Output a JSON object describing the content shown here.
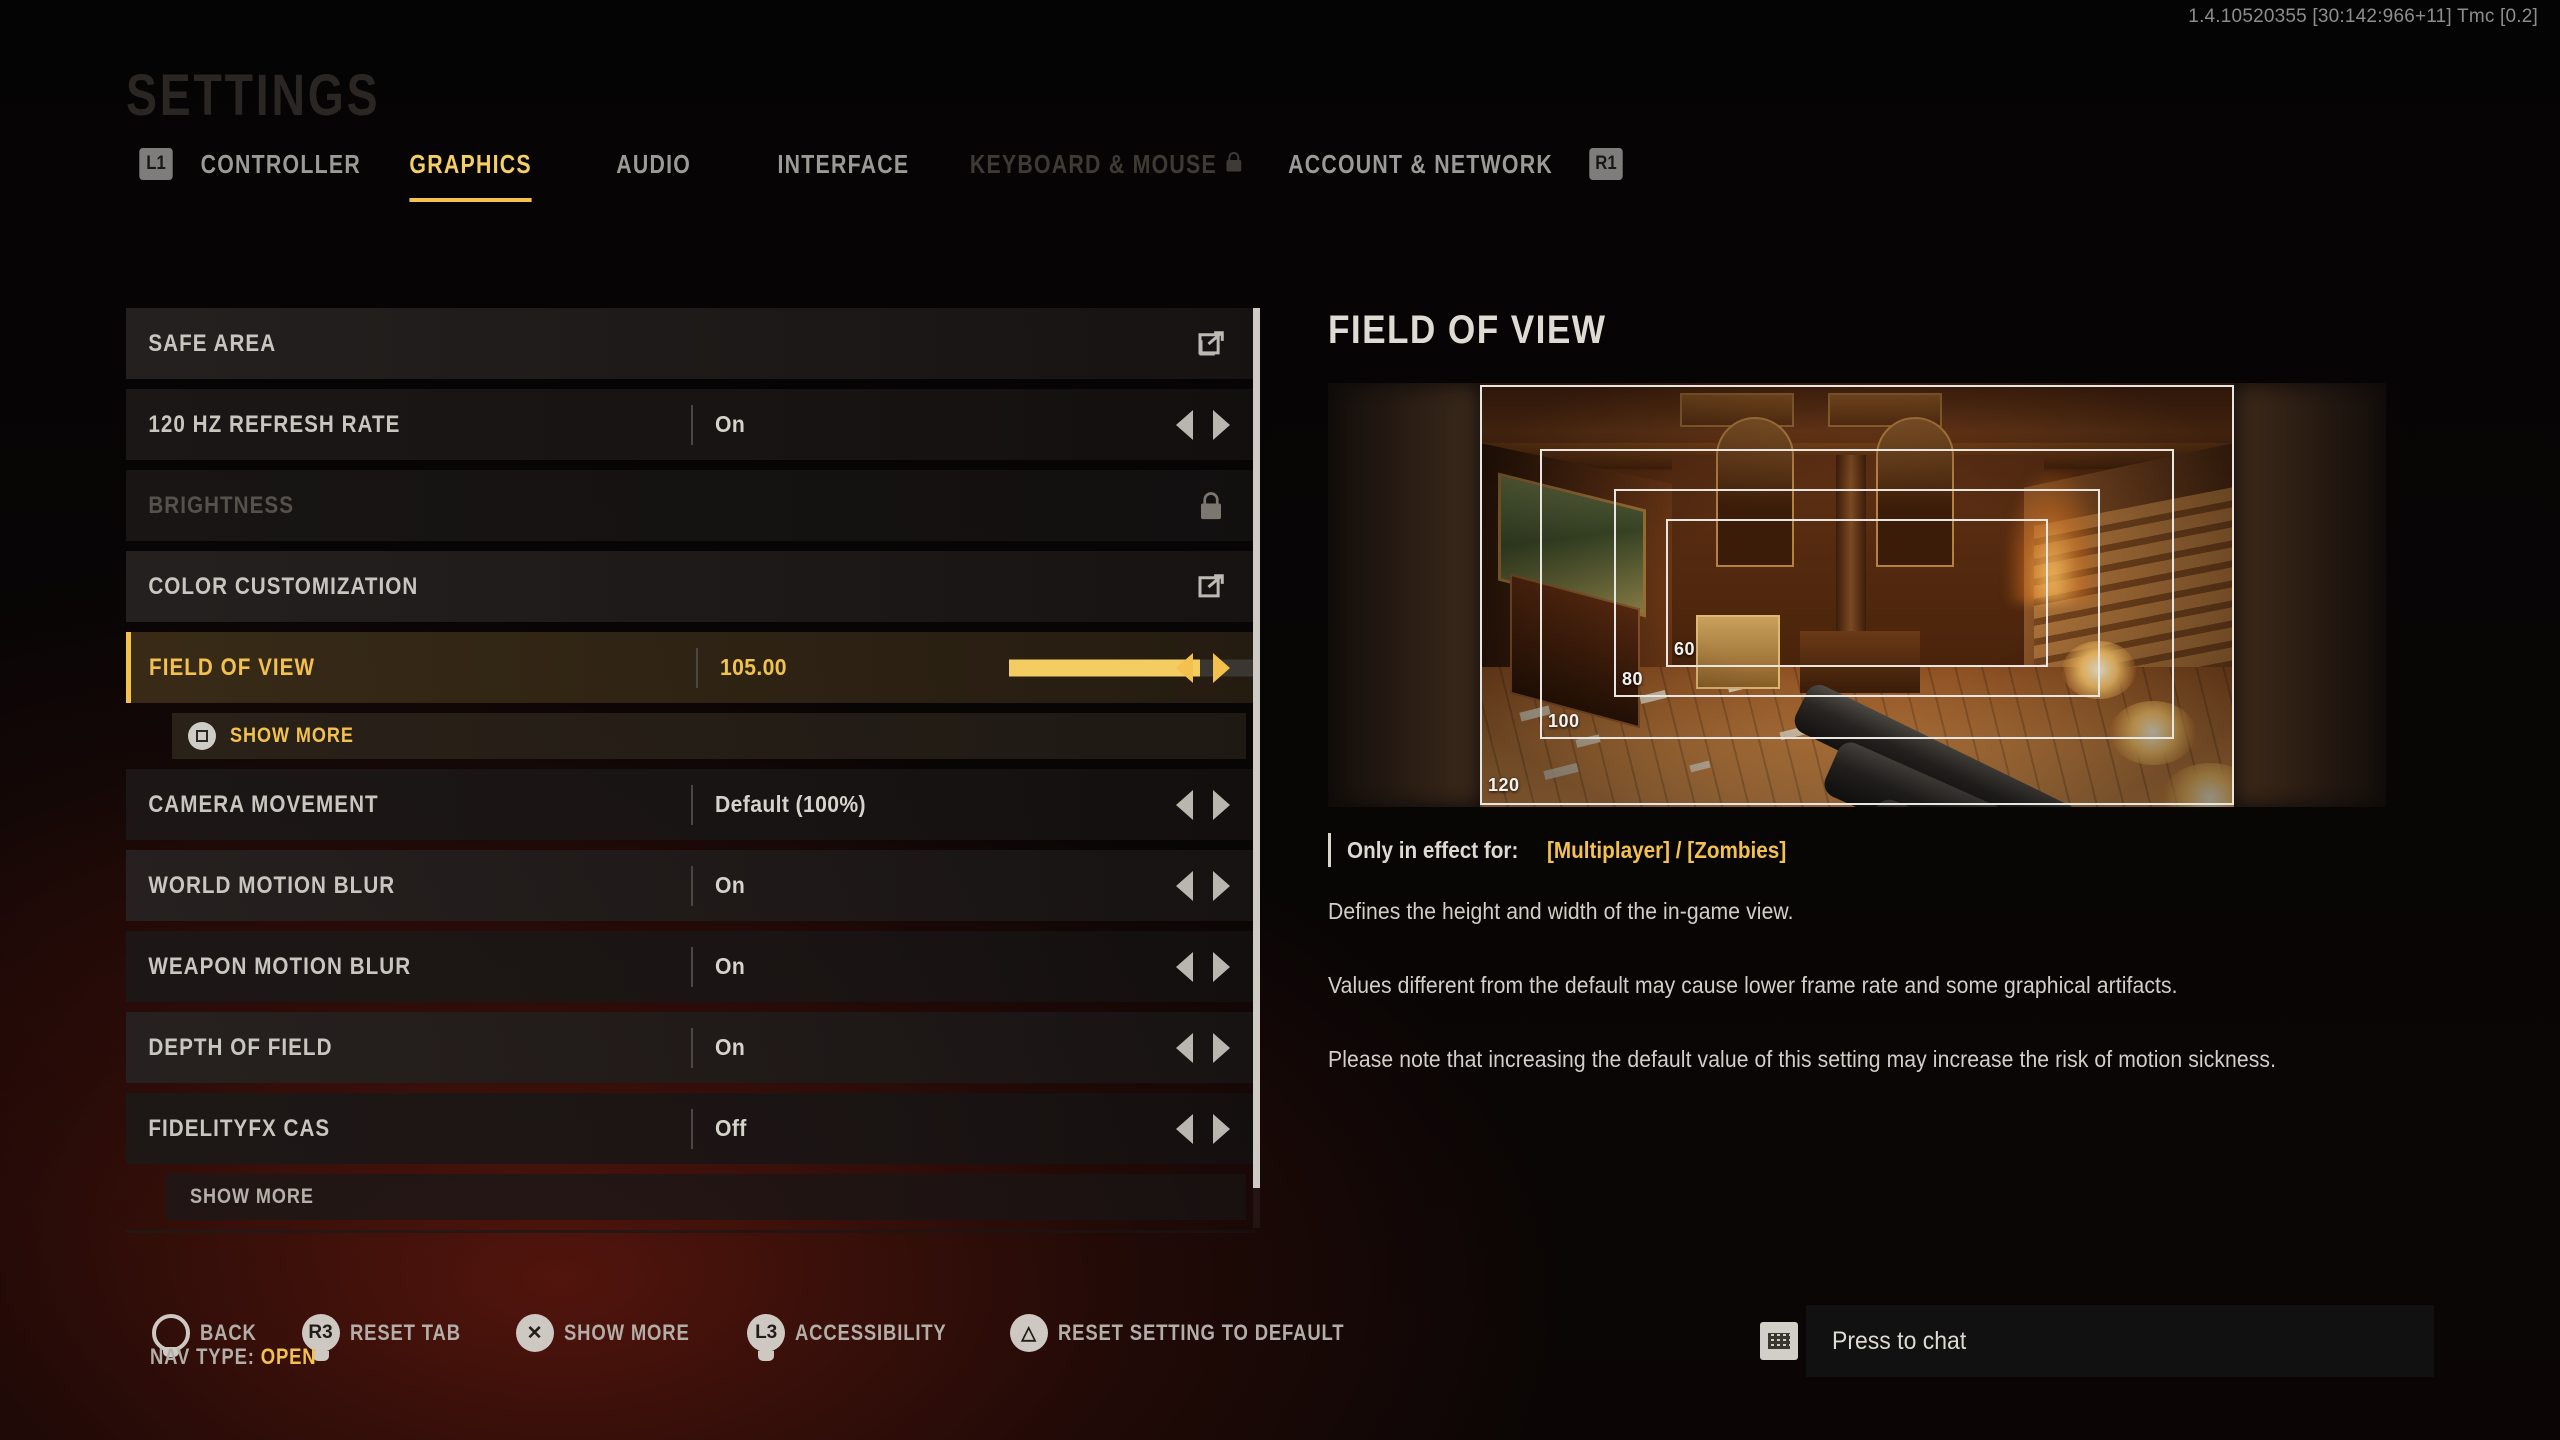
{
  "version_string": "1.4.10520355 [30:142:966+11] Tmc [0.2]",
  "header": {
    "title": "SETTINGS",
    "left_bumper": "L1",
    "right_bumper": "R1",
    "tabs": [
      {
        "label": "CONTROLLER",
        "state": "normal"
      },
      {
        "label": "GRAPHICS",
        "state": "active"
      },
      {
        "label": "AUDIO",
        "state": "normal"
      },
      {
        "label": "INTERFACE",
        "state": "normal"
      },
      {
        "label": "KEYBOARD & MOUSE",
        "state": "locked",
        "lock_icon": "lock-icon"
      },
      {
        "label": "ACCOUNT & NETWORK",
        "state": "normal"
      }
    ]
  },
  "settings_list": {
    "rows": [
      {
        "label": "SAFE AREA",
        "value": "",
        "type": "link",
        "icon": "external-link-icon"
      },
      {
        "label": "120 HZ REFRESH RATE",
        "value": "On",
        "type": "stepper"
      },
      {
        "label": "BRIGHTNESS",
        "value": "",
        "type": "locked",
        "icon": "lock-icon"
      },
      {
        "label": "COLOR CUSTOMIZATION",
        "value": "",
        "type": "link",
        "icon": "external-link-icon"
      },
      {
        "label": "FIELD OF VIEW",
        "value": "105.00",
        "type": "slider",
        "slider_percent": 75,
        "selected": true
      },
      {
        "label": "CAMERA MOVEMENT",
        "value": "Default (100%)",
        "type": "stepper"
      },
      {
        "label": "WORLD MOTION BLUR",
        "value": "On",
        "type": "stepper"
      },
      {
        "label": "WEAPON MOTION BLUR",
        "value": "On",
        "type": "stepper"
      },
      {
        "label": "DEPTH OF FIELD",
        "value": "On",
        "type": "stepper"
      },
      {
        "label": "FIDELITYFX CAS",
        "value": "Off",
        "type": "stepper"
      }
    ],
    "show_more_selected": "SHOW MORE",
    "show_more_bottom": "SHOW MORE"
  },
  "detail": {
    "title": "FIELD OF VIEW",
    "preview": {
      "fov_frames": [
        {
          "label": "120"
        },
        {
          "label": "100"
        },
        {
          "label": "80"
        },
        {
          "label": "60"
        }
      ]
    },
    "effect_label": "Only in effect for:",
    "effect_modes": "[Multiplayer] / [Zombies]",
    "paragraphs": [
      "Defines the height and width of the in-game view.",
      "Values different from the default may cause lower frame rate and some graphical artifacts.",
      "Please note that increasing the default value of this setting may increase the risk of motion sickness."
    ]
  },
  "action_bar": {
    "actions": [
      {
        "glyph": "",
        "glyph_kind": "circle-ring",
        "icon": "circle-button-icon",
        "label": "BACK"
      },
      {
        "glyph": "R3",
        "glyph_kind": "stick",
        "icon": "r3-stick-icon",
        "label": "RESET TAB"
      },
      {
        "glyph": "✕",
        "glyph_kind": "cross",
        "icon": "cross-button-icon",
        "label": "SHOW MORE"
      },
      {
        "glyph": "L3",
        "glyph_kind": "stick",
        "icon": "l3-stick-icon",
        "label": "ACCESSIBILITY"
      },
      {
        "glyph": "△",
        "glyph_kind": "triangle",
        "icon": "triangle-button-icon",
        "label": "RESET SETTING TO DEFAULT"
      }
    ],
    "nav_type_prefix": "NAV TYPE: ",
    "nav_type_value": "OPEN"
  },
  "chat": {
    "icon": "touchpad-icon",
    "text": "Press to chat"
  },
  "colors": {
    "accent": "#f2c14e",
    "text_primary": "#d6d2cc",
    "text_muted": "#9c9a96",
    "text_disabled": "#57514c",
    "row_bg": "#262221",
    "selected_row_bg": "#3a2c18"
  }
}
